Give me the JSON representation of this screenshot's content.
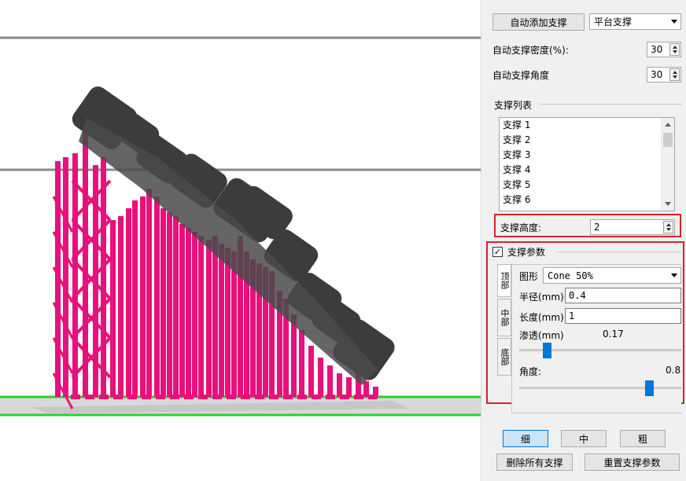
{
  "toolbar": {
    "auto_add_support": "自动添加支撑",
    "support_type_selected": "平台支撑"
  },
  "auto_density": {
    "label": "自动支撑密度(%):",
    "value": "30"
  },
  "auto_angle": {
    "label": "自动支撑角度",
    "value": "30"
  },
  "support_list": {
    "title": "支撑列表",
    "items": [
      "支撑 1",
      "支撑 2",
      "支撑 3",
      "支撑 4",
      "支撑 5",
      "支撑 6"
    ]
  },
  "support_height": {
    "label": "支撑高度:",
    "value": "2"
  },
  "support_params": {
    "title": "支撑参数",
    "checked": true,
    "tabs": [
      "顶部",
      "中部",
      "底部"
    ],
    "shape": {
      "label": "图形",
      "value": "Cone 50%"
    },
    "radius": {
      "label": "半径(mm)",
      "value": "0.4"
    },
    "length": {
      "label": "长度(mm)",
      "value": "1"
    },
    "penetration": {
      "label": "渗透(mm)",
      "value": "0.17",
      "level": 0.17
    },
    "angle": {
      "label": "角度:",
      "value": "0.8",
      "level": 0.8
    }
  },
  "size_buttons": [
    "细",
    "中",
    "粗"
  ],
  "actions": {
    "delete_all": "删除所有支撑",
    "reset_params": "重置支撑参数"
  },
  "colors": {
    "support": "#e8107a",
    "model": "#3c3c3c",
    "platform": "#22d42a",
    "highlight": "#d0252b",
    "accent": "#0078d7"
  }
}
